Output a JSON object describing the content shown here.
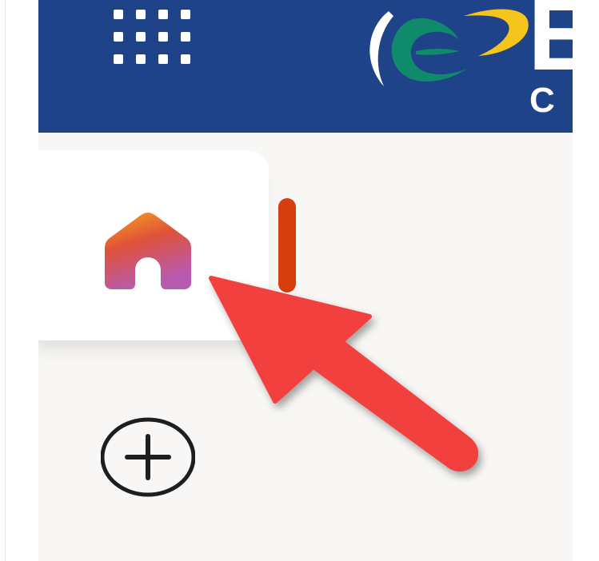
{
  "header": {
    "brand_letter": "E",
    "brand_sub": "C",
    "background_color": "#1f4388"
  },
  "nav": {
    "home": {
      "icon": "home-icon",
      "active": true
    },
    "add": {
      "icon": "plus-circle-icon"
    }
  },
  "colors": {
    "active_indicator": "#d63d0f",
    "annotation_arrow": "#f1413e",
    "tile_background": "#ffffff",
    "app_background": "#f8f7f5"
  }
}
